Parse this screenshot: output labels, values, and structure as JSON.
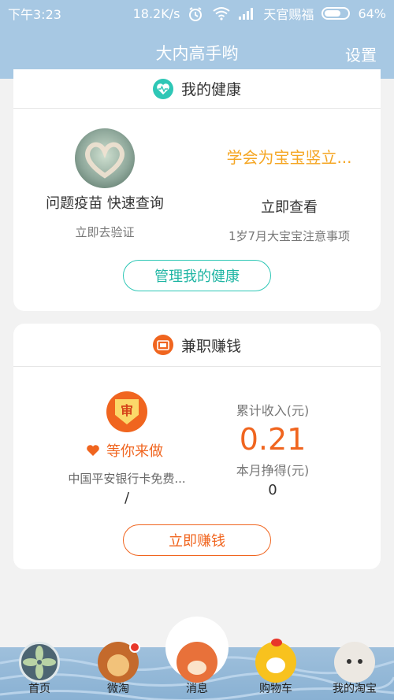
{
  "status_bar": {
    "time": "下午3:23",
    "speed": "18.2K/s",
    "carrier": "天官赐福",
    "battery": "64%",
    "battery_level": 0.64
  },
  "header": {
    "title": "大内高手哟",
    "settings_label": "设置"
  },
  "health_card": {
    "title": "我的健康",
    "left": {
      "main": "问题疫苗 快速查询",
      "sub": "立即去验证"
    },
    "right": {
      "highlight": "学会为宝宝竖立...",
      "main": "立即查看",
      "sub": "1岁7月大宝宝注意事项"
    },
    "button_label": "管理我的健康"
  },
  "job_card": {
    "title": "兼职赚钱",
    "badge_char": "审",
    "waiting_label": "等你来做",
    "task_name": "中国平安银行卡免费...",
    "task_slash": "/",
    "total_income_label": "累计收入(元)",
    "total_income_value": "0.21",
    "month_label": "本月挣得(元)",
    "month_value": "0",
    "button_label": "立即赚钱"
  },
  "tabs": [
    {
      "label": "首页",
      "icon": "fan-icon"
    },
    {
      "label": "微淘",
      "icon": "lion-icon"
    },
    {
      "label": "消息",
      "icon": "fox-icon"
    },
    {
      "label": "购物车",
      "icon": "chick-icon"
    },
    {
      "label": "我的淘宝",
      "icon": "seal-icon"
    }
  ],
  "colors": {
    "header_bg": "#a7c8e3",
    "teal": "#2ec7b6",
    "orange": "#f0651f",
    "gold": "#f5a623"
  }
}
